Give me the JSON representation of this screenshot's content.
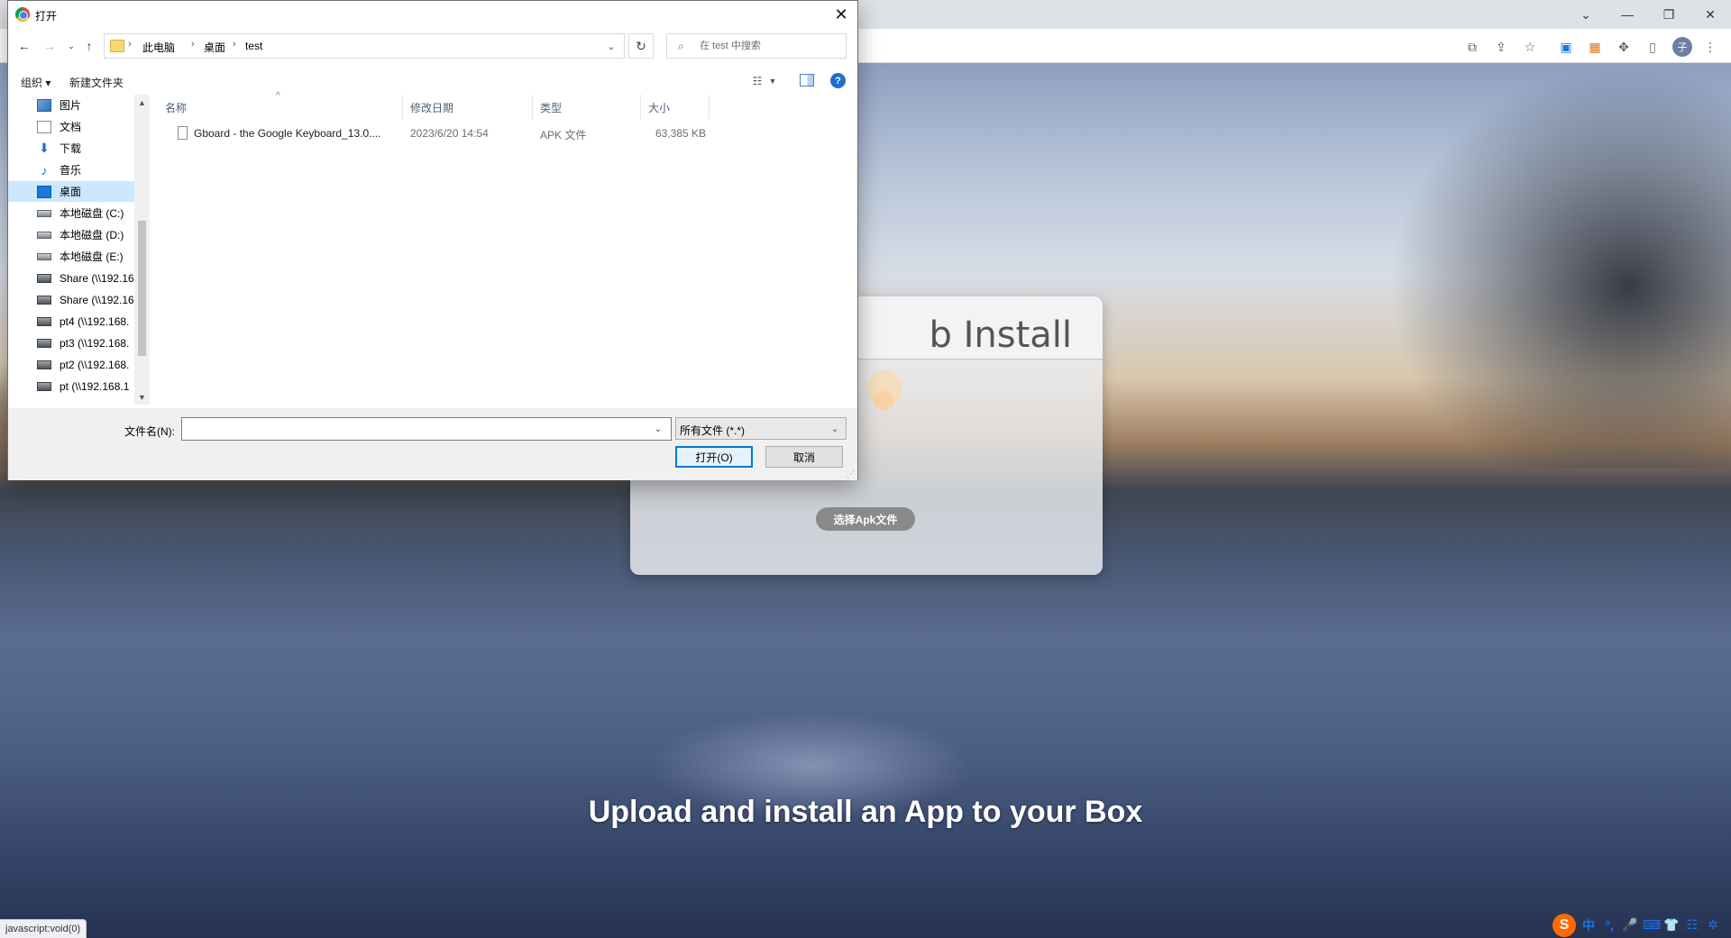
{
  "browser": {
    "win_min": "—",
    "win_restore": "❐",
    "win_close": "✕",
    "win_menu": "⌄",
    "profile_initial": "子",
    "menu_dots": "⋮"
  },
  "page": {
    "card_title": "b Install",
    "apk_button": "选择Apk文件",
    "hero": "Upload and install an App to your Box",
    "status_url": "javascript:void(0)"
  },
  "ime": {
    "logo": "S",
    "items": [
      "中",
      "°,",
      "🎤",
      "⌨",
      "👕",
      "☷",
      "✲"
    ]
  },
  "dialog": {
    "title": "打开",
    "close": "✕",
    "breadcrumb": [
      "此电脑",
      "桌面",
      "test"
    ],
    "search_placeholder": "在 test 中搜索",
    "commands": {
      "organize": "组织 ▾",
      "new_folder": "新建文件夹"
    },
    "help": "?",
    "nav_items": [
      {
        "label": "图片",
        "icon": "pictures-icon"
      },
      {
        "label": "文档",
        "icon": "documents-icon"
      },
      {
        "label": "下载",
        "icon": "downloads-icon"
      },
      {
        "label": "音乐",
        "icon": "music-icon"
      },
      {
        "label": "桌面",
        "icon": "desktop-icon",
        "selected": true
      },
      {
        "label": "本地磁盘 (C:)",
        "icon": "drive-icon"
      },
      {
        "label": "本地磁盘 (D:)",
        "icon": "drive-icon"
      },
      {
        "label": "本地磁盘 (E:)",
        "icon": "drive-icon"
      },
      {
        "label": "Share (\\\\192.16",
        "icon": "network-drive-icon"
      },
      {
        "label": "Share (\\\\192.16",
        "icon": "network-drive-icon"
      },
      {
        "label": "pt4 (\\\\192.168.",
        "icon": "network-drive-icon"
      },
      {
        "label": "pt3 (\\\\192.168.",
        "icon": "network-drive-icon"
      },
      {
        "label": "pt2 (\\\\192.168.",
        "icon": "network-drive-icon"
      },
      {
        "label": "pt (\\\\192.168.1",
        "icon": "network-drive-icon"
      }
    ],
    "columns": {
      "name": "名称",
      "date": "修改日期",
      "type": "类型",
      "size": "大小"
    },
    "files": [
      {
        "name": "Gboard - the Google Keyboard_13.0....",
        "date": "2023/6/20 14:54",
        "type": "APK 文件",
        "size": "63,385 KB"
      }
    ],
    "filename_label": "文件名(N):",
    "filename_value": "",
    "filetype": "所有文件 (*.*)",
    "open_button": "打开(O)",
    "cancel_button": "取消"
  }
}
